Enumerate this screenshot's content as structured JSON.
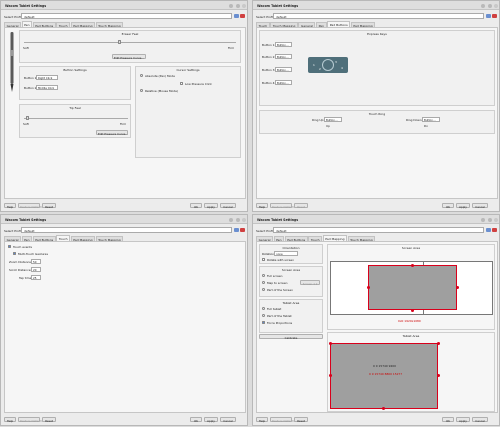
{
  "title": "Wacom Tablet Settings",
  "profile": {
    "label": "Select Profile:",
    "value": "default"
  },
  "tabs": [
    "General",
    "Pen",
    "Pad Buttons",
    "Touch",
    "Pad Mapping",
    "Touch Mapping"
  ],
  "tabs2": [
    "Touch",
    "Touch Mapping",
    "General",
    "Pen",
    "Pad Buttons",
    "Pad Mapping"
  ],
  "buttons": {
    "help": "Help",
    "defaults": "Restore Defaults",
    "reset": "Reset",
    "ok": "OK",
    "apply": "Apply",
    "cancel": "Cancel"
  },
  "pen": {
    "eraser_feel": "Eraser Feel",
    "soft": "Soft",
    "firm": "Firm",
    "edit_pressure": "Edit Pressure Curve...",
    "button_settings": "Button Settings",
    "button1": "Button 1:",
    "button1_val": "Right Click",
    "button2": "Button 2:",
    "button2_val": "Middle Click",
    "tip_feel": "Tip Feel",
    "cursor_settings": "Cursor Settings",
    "absolute": "Absolute (Pen) Mode",
    "relative": "Relative (Mouse Mode)",
    "low_pressure": "Low Pressure Click"
  },
  "pad": {
    "express_keys": "Express Keys",
    "button1": "Button 1:",
    "button2": "Button 2:",
    "button3": "Button 3:",
    "button4": "Button 4:",
    "button_val": "Button...",
    "ring": [
      "1",
      "2",
      "3",
      "4"
    ],
    "touch_ring": "Touch Ring",
    "ring_up": "Ring Up:",
    "ring_down": "Ring Down:",
    "ring_up_val": "Button...",
    "ring_down_val": "Button...",
    "ring_up_sub": "Up",
    "ring_down_sub": "Dn"
  },
  "touch": {
    "touch_events": "Touch events",
    "multitouch": "Multi-Touch Gestures",
    "zoom": "Zoom Distance:",
    "zoom_val": "50",
    "scroll": "Scroll Distance:",
    "scroll_val": "20",
    "tap": "Tap time:",
    "tap_val": "25"
  },
  "mapping": {
    "orientation": "Orientation",
    "rotation_label": "Rotation:",
    "rotation_val": "none",
    "rotate_with_screen": "Rotate with screen",
    "screen_area": "Screen Area",
    "full_screen": "Full screen",
    "map_to_screen": "Map to screen",
    "part_of_screen": "Part of the Screen",
    "screen_btn": "Screen 1 ▾",
    "tablet_area": "Tablet Area",
    "full_tablet": "Full tablet",
    "part_tablet": "Part of the Tablet",
    "force_prop": "Force Proportions",
    "calibrate": "Calibrate",
    "screen_area_title": "Screen Area",
    "screen_dims": "0x0 1920x1080",
    "tablet_area_title": "Tablet Area",
    "tablet_dims1": "0 0 15740 9200",
    "tablet_dims2": "0 9 15740 8800 15277"
  },
  "colors": {
    "selection": "#9f9f9f",
    "handle": "#d9001b",
    "accent": "#5b8ad9"
  }
}
